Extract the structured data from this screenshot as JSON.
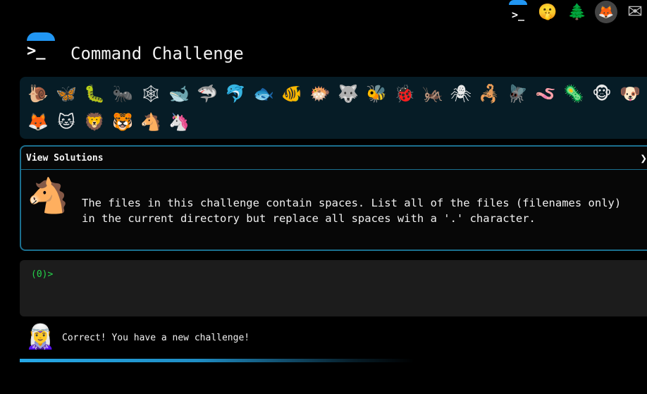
{
  "header": {
    "title": "Command Challenge",
    "logo_glyph": ">_"
  },
  "top_icons": [
    {
      "name": "command-challenge-logo-icon",
      "glyph": ">_"
    },
    {
      "name": "shushing-face-icon",
      "glyph": "🤫"
    },
    {
      "name": "evergreen-tree-icon",
      "glyph": "🌲"
    },
    {
      "name": "gitlab-icon",
      "glyph": "🦊"
    },
    {
      "name": "envelope-icon",
      "glyph": "✉"
    }
  ],
  "animals": [
    {
      "name": "snail",
      "glyph": "🐌"
    },
    {
      "name": "butterfly",
      "glyph": "🦋"
    },
    {
      "name": "caterpillar",
      "glyph": "🐛"
    },
    {
      "name": "ant",
      "glyph": "🐜"
    },
    {
      "name": "spider-web",
      "glyph": "🕸"
    },
    {
      "name": "whale",
      "glyph": "🐋"
    },
    {
      "name": "shark",
      "glyph": "🦈"
    },
    {
      "name": "dolphin",
      "glyph": "🐬"
    },
    {
      "name": "fish",
      "glyph": "🐟"
    },
    {
      "name": "tropical-fish",
      "glyph": "🐠"
    },
    {
      "name": "blowfish",
      "glyph": "🐡"
    },
    {
      "name": "wolf",
      "glyph": "🐺"
    },
    {
      "name": "bee",
      "glyph": "🐝"
    },
    {
      "name": "ladybug",
      "glyph": "🐞"
    },
    {
      "name": "cricket",
      "glyph": "🦗"
    },
    {
      "name": "spider",
      "glyph": "🕷"
    },
    {
      "name": "scorpion",
      "glyph": "🦂"
    },
    {
      "name": "fly",
      "glyph": "🪰"
    },
    {
      "name": "worm",
      "glyph": "🪱"
    },
    {
      "name": "microbe",
      "glyph": "🦠"
    },
    {
      "name": "monkey",
      "glyph": "🐵"
    },
    {
      "name": "dog",
      "glyph": "🐶"
    },
    {
      "name": "fox",
      "glyph": "🦊"
    },
    {
      "name": "cat",
      "glyph": "🐱"
    },
    {
      "name": "lion",
      "glyph": "🦁"
    },
    {
      "name": "tiger",
      "glyph": "🐯"
    },
    {
      "name": "horse",
      "glyph": "🐴"
    },
    {
      "name": "unicorn",
      "glyph": "🦄"
    }
  ],
  "solutions_panel": {
    "header": "View Solutions",
    "chevron": "❯",
    "icon": "🐴",
    "description": "The files in this challenge contain spaces. List all of the files (filenames only)\nin the current directory but replace all spaces with a '.' character."
  },
  "terminal": {
    "prompt": "(0)>",
    "input_value": ""
  },
  "status": {
    "icon": "🧝‍♀️",
    "message": "Correct! You have a new challenge!",
    "progress_percent": 100
  },
  "colors": {
    "background": "#000000",
    "accent": "#1b6f8e",
    "prompt_green": "#25d24a",
    "progress_blue": "#26a8e6"
  }
}
